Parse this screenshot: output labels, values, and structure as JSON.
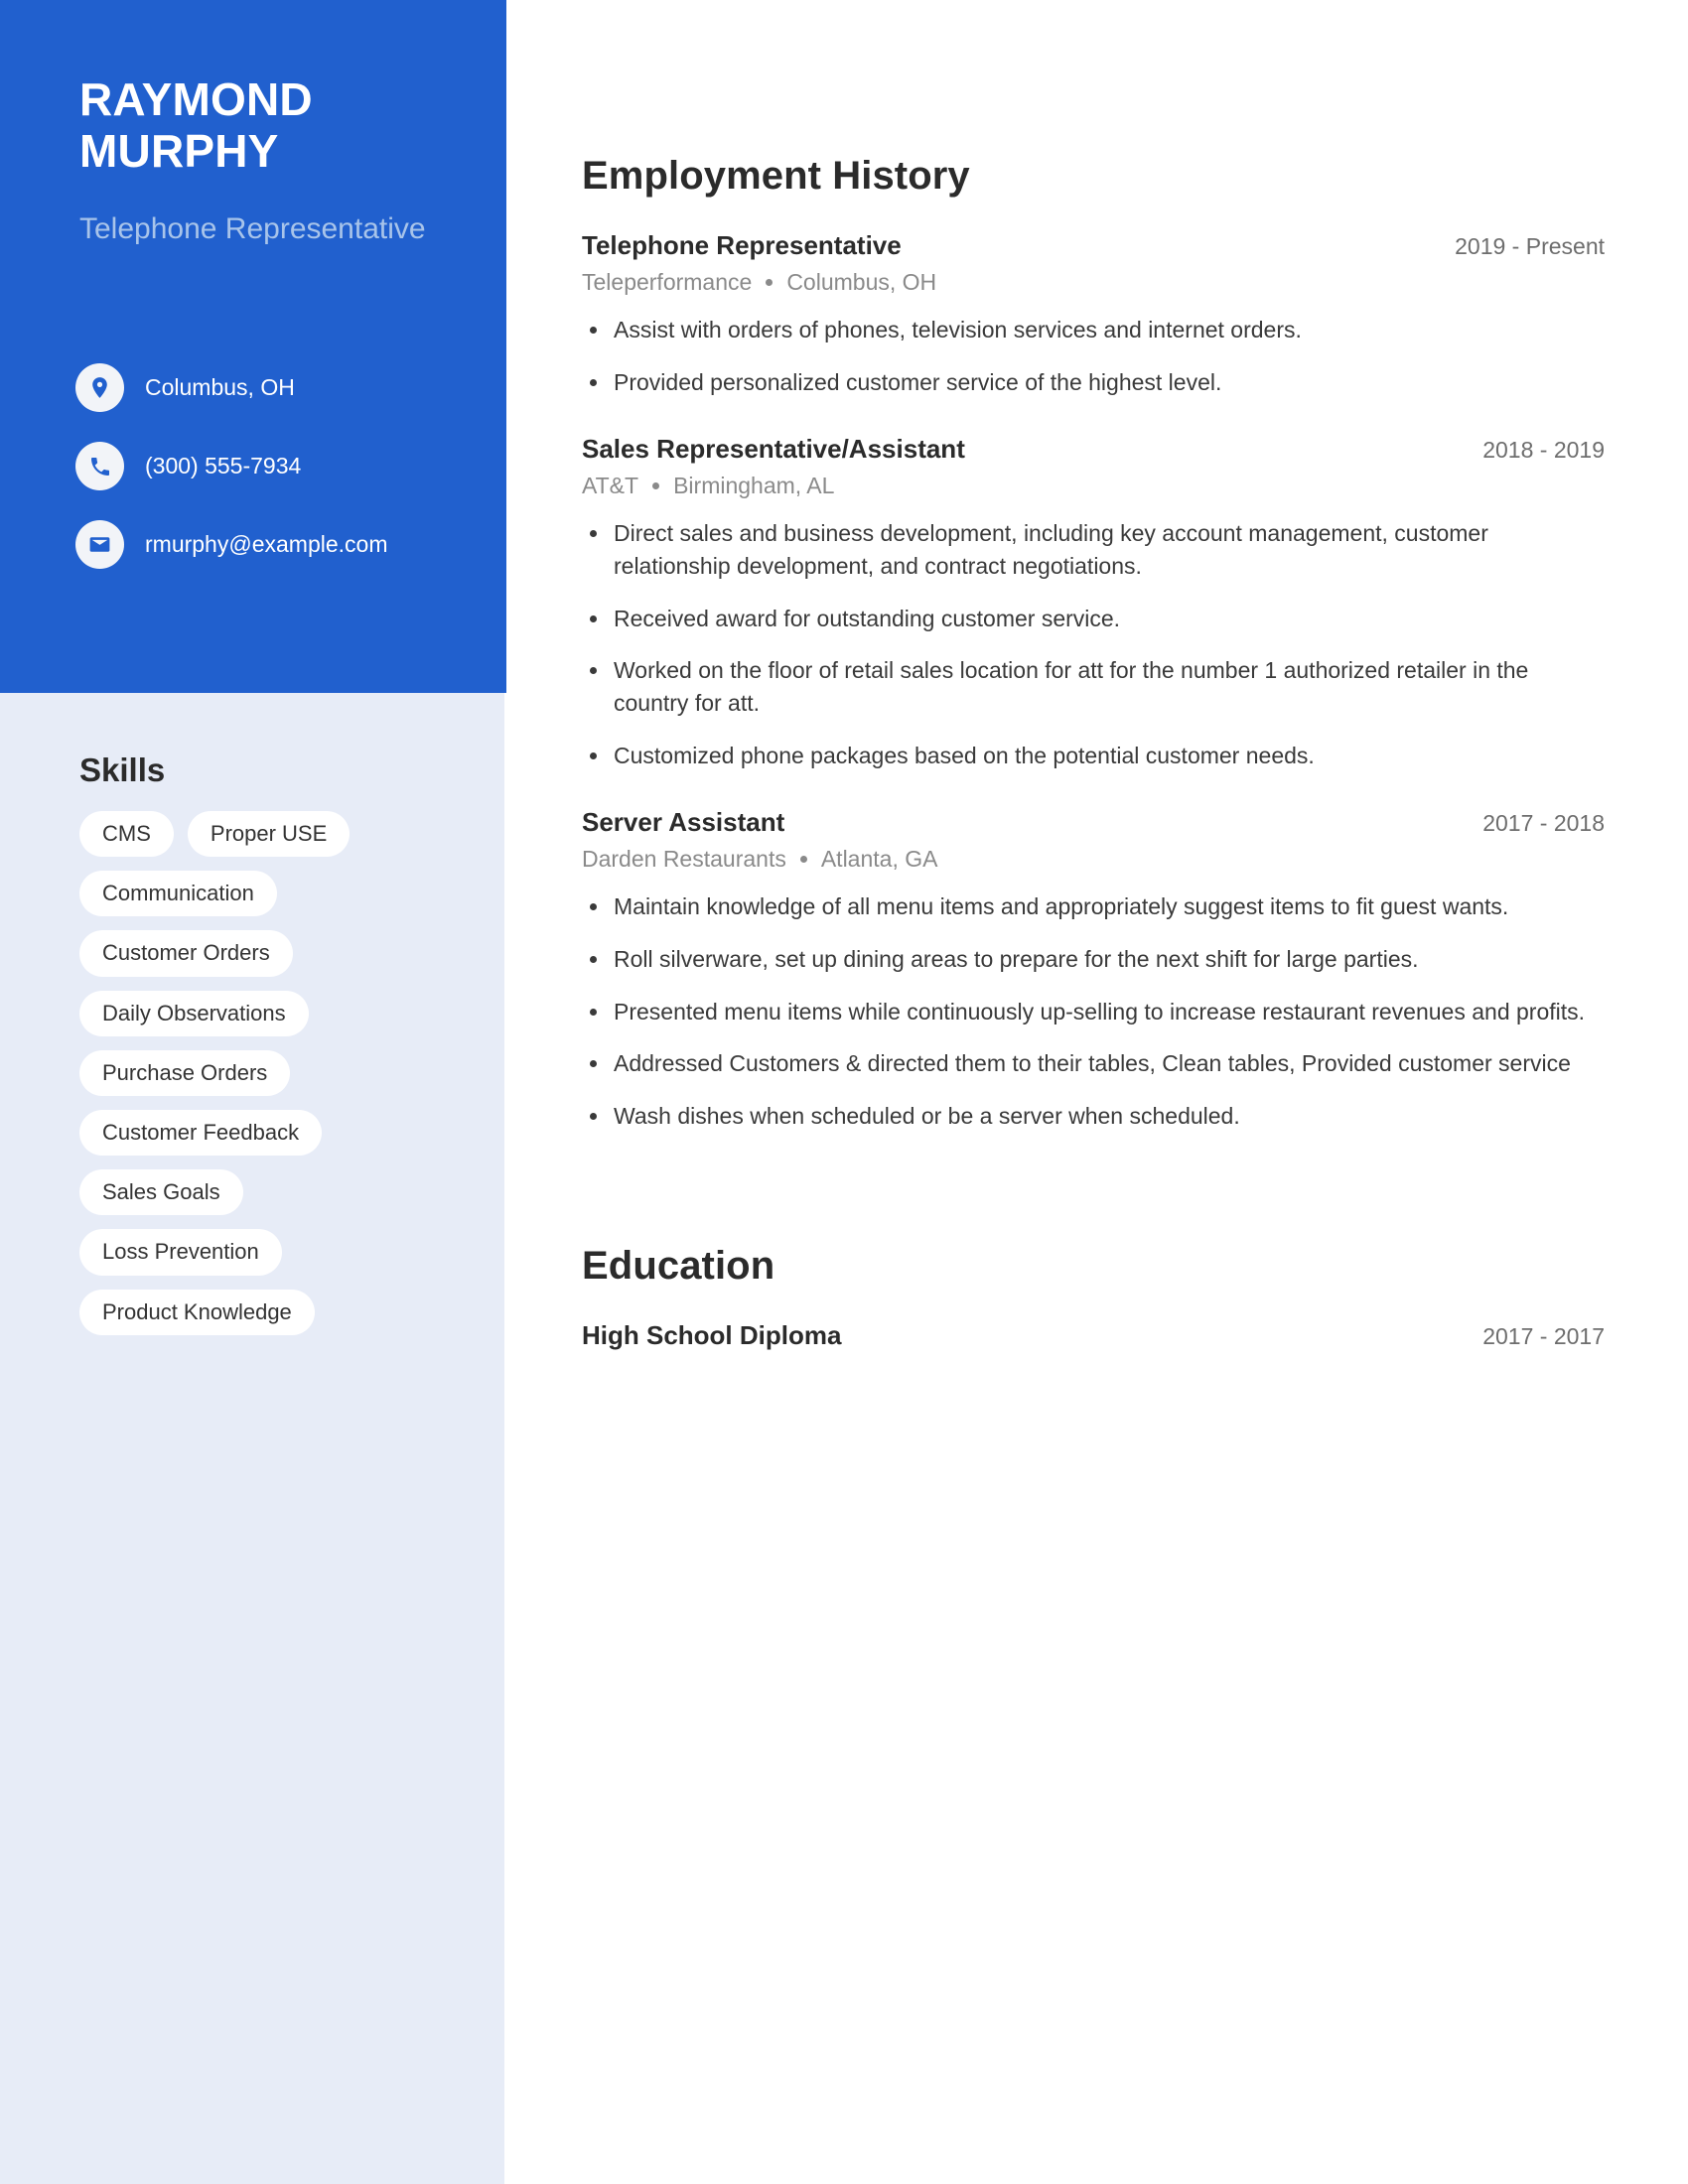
{
  "theme": {
    "accent": "#2160ce",
    "sidebar_panel": "#e7ecf7",
    "subtitle_color": "#a8c4ea",
    "pill_bg": "#ffffff"
  },
  "sidebar": {
    "name_first": "RAYMOND",
    "name_last": "MURPHY",
    "job_title": "Telephone Representative",
    "contact": [
      {
        "icon": "location-pin-icon",
        "value": "Columbus, OH"
      },
      {
        "icon": "phone-icon",
        "value": "(300) 555-7934"
      },
      {
        "icon": "email-icon",
        "value": "rmurphy@example.com"
      }
    ],
    "skills_title": "Skills",
    "skills": [
      "CMS",
      "Proper USE",
      "Communication",
      "Customer Orders",
      "Daily Observations",
      "Purchase Orders",
      "Customer Feedback",
      "Sales Goals",
      "Loss Prevention",
      "Product Knowledge"
    ]
  },
  "main": {
    "employment_heading": "Employment History",
    "employment": [
      {
        "title": "Telephone Representative",
        "company": "Teleperformance",
        "location": "Columbus, OH",
        "dates": "2019 - Present",
        "bullets": [
          "Assist with orders of phones, television services and internet orders.",
          "Provided personalized customer service of the highest level."
        ]
      },
      {
        "title": "Sales Representative/Assistant",
        "company": "AT&T",
        "location": "Birmingham, AL",
        "dates": "2018 - 2019",
        "bullets": [
          "Direct sales and business development, including key account management, customer relationship development, and contract negotiations.",
          "Received award for outstanding customer service.",
          "Worked on the floor of retail sales location for att for the number 1 authorized retailer in the country for att.",
          "Customized phone packages based on the potential customer needs."
        ]
      },
      {
        "title": "Server Assistant",
        "company": "Darden Restaurants",
        "location": "Atlanta, GA",
        "dates": "2017 - 2018",
        "bullets": [
          "Maintain knowledge of all menu items and appropriately suggest items to fit guest wants.",
          "Roll silverware, set up dining areas to prepare for the next shift for large parties.",
          "Presented menu items while continuously up-selling to increase restaurant revenues and profits.",
          "Addressed Customers & directed them to their tables, Clean tables, Provided customer service",
          "Wash dishes when scheduled or be a server when scheduled."
        ]
      }
    ],
    "education_heading": "Education",
    "education": [
      {
        "title": "High School Diploma",
        "dates": "2017 - 2017"
      }
    ]
  }
}
